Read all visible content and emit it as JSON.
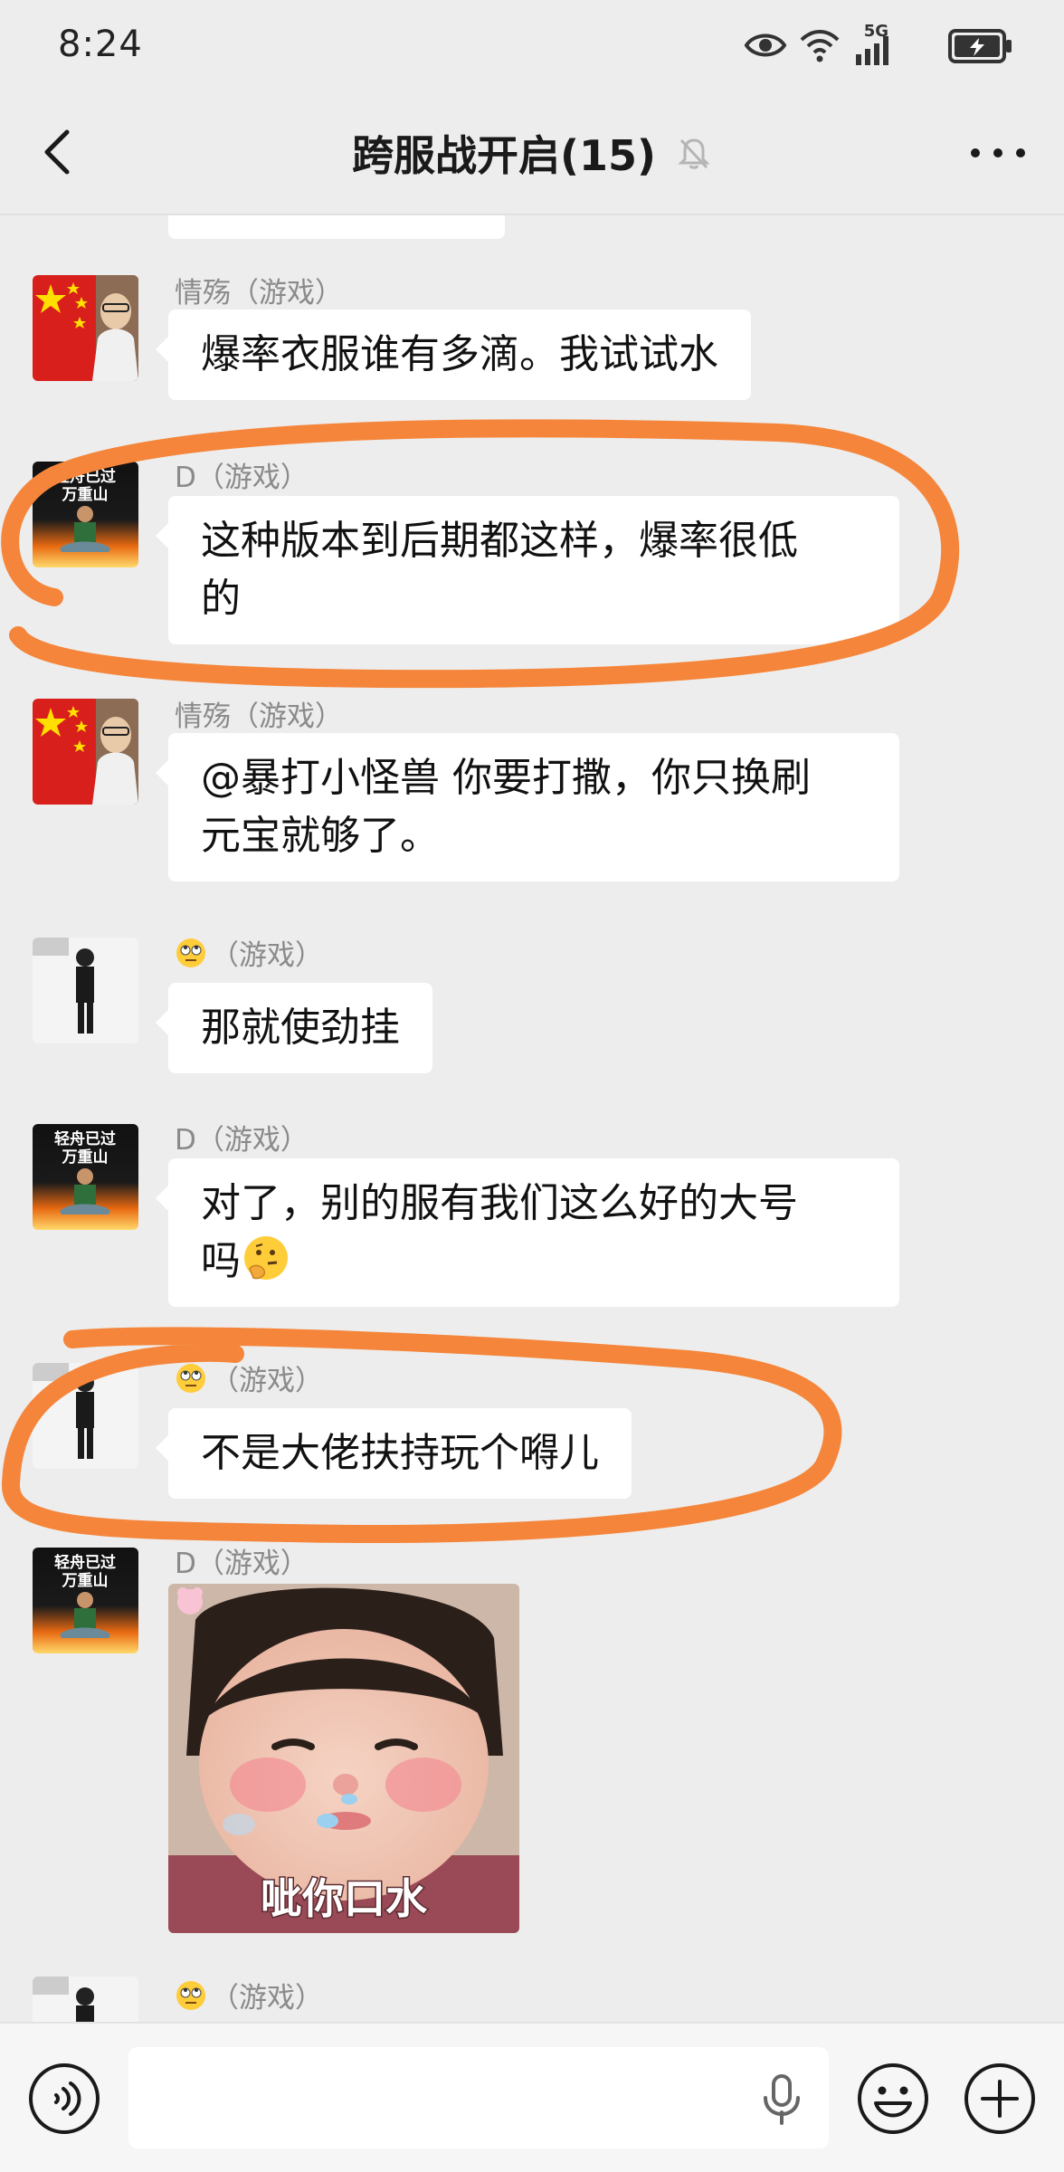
{
  "status_bar": {
    "time": "8:24",
    "network": "5G"
  },
  "header": {
    "title": "跨服战开启(15)"
  },
  "chat": {
    "messages": [
      {
        "sender": "情殇（游戏）",
        "text": "爆率衣服谁有多滴。我试试水"
      },
      {
        "sender": "D（游戏）",
        "line1": "这种版本到后期都这样，爆率很低",
        "line2": "的"
      },
      {
        "sender": "情殇（游戏）",
        "line1": "@暴打小怪兽  你要打撒，你只换刷",
        "line2": "元宝就够了。"
      },
      {
        "sender": "（游戏）",
        "text": "那就使劲挂"
      },
      {
        "sender": "D（游戏）",
        "line1": "对了，别的服有我们这么好的大号",
        "line2": "吗"
      },
      {
        "sender": "（游戏）",
        "text": "不是大佬扶持玩个嘚儿"
      },
      {
        "sender": "D（游戏）",
        "sticker_caption": "呲你口水"
      },
      {
        "sender": "（游戏）"
      }
    ],
    "avatar_text": {
      "line1": "轻舟已过",
      "line2": "万重山"
    }
  },
  "input_bar": {
    "placeholder": ""
  },
  "colors": {
    "background": "#ededed",
    "bubble": "#ffffff",
    "annotation_orange": "#f5853a",
    "sender_gray": "#8a8a8a"
  },
  "icons": {
    "status": [
      "eye-icon",
      "wifi-icon",
      "signal-icon",
      "battery-icon"
    ],
    "header": [
      "back-arrow-icon",
      "mute-bell-icon",
      "more-dots-icon"
    ],
    "input": [
      "voice-icon",
      "mic-icon",
      "emoji-icon",
      "plus-icon"
    ]
  }
}
